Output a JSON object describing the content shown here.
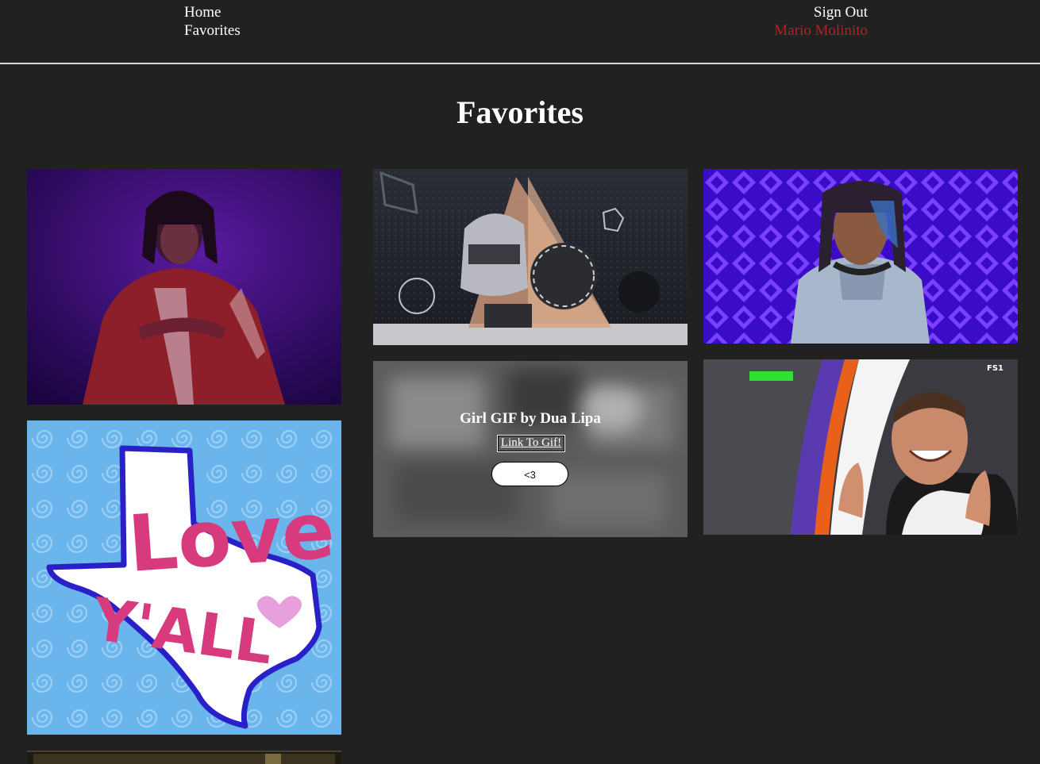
{
  "nav": {
    "home": "Home",
    "favorites": "Favorites",
    "sign_out": "Sign Out",
    "user": "Mario Molinito"
  },
  "page": {
    "title": "Favorites"
  },
  "overlay": {
    "title": "Girl GIF by Dua Lipa",
    "link": "Link To Gif!",
    "button": "<3"
  },
  "tiles": {
    "love_text_top": "Love",
    "love_text_bottom": "Y'ALL",
    "nbc_mark": "FS1"
  },
  "colors": {
    "background": "#212121",
    "accent": "#b0212b",
    "button": "#ffffff"
  }
}
